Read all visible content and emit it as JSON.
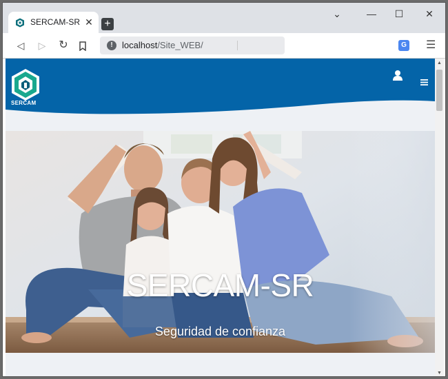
{
  "browser": {
    "tab_title": "SERCAM-SR",
    "tab_close": "✕",
    "new_tab": "+",
    "url_host": "localhost",
    "url_path": "/Site_WEB/",
    "info_icon": "!",
    "translate_icon": "G",
    "menu_icon": "☰",
    "win_min": "—",
    "win_max": "☐",
    "win_close": "✕",
    "win_chevron": "⌄",
    "back": "◁",
    "forward": "▷",
    "reload": "↻",
    "bookmark": "⍞"
  },
  "site": {
    "logo_text": "SERCAM",
    "hero_title": "SERCAM-SR",
    "hero_subtitle": "Seguridad de confianza"
  },
  "colors": {
    "brand_blue": "#0464a8",
    "logo_teal": "#1aa88e"
  }
}
